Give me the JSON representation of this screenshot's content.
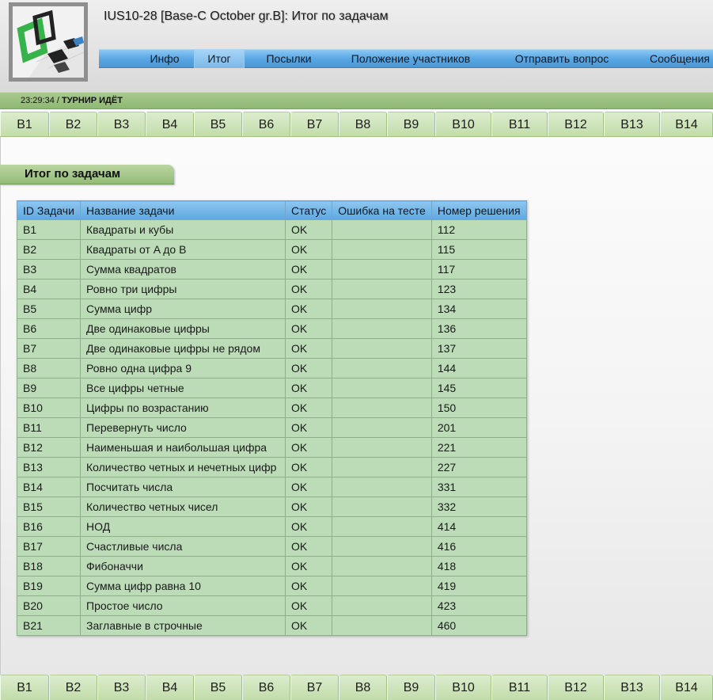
{
  "header": {
    "title": "IUS10-28 [Base-C October gr.B]: Итог по задачам"
  },
  "nav": {
    "items": [
      {
        "label": "Инфо",
        "active": false
      },
      {
        "label": "Итог",
        "active": true
      },
      {
        "label": "Посылки",
        "active": false
      },
      {
        "label": "Положение участников",
        "active": false
      },
      {
        "label": "Отправить вопрос",
        "active": false
      },
      {
        "label": "Сообщения",
        "active": false
      }
    ]
  },
  "status": {
    "time": "23:29:34",
    "separator": " / ",
    "state": "ТУРНИР ИДЁТ"
  },
  "problem_tabs": [
    "B1",
    "B2",
    "B3",
    "B4",
    "B5",
    "B6",
    "B7",
    "B8",
    "B9",
    "B10",
    "B11",
    "B12",
    "B13",
    "B14"
  ],
  "section": {
    "title": "Итог по задачам"
  },
  "table": {
    "headers": [
      "ID Задачи",
      "Название задачи",
      "Статус",
      "Ошибка на тесте",
      "Номер решения"
    ],
    "rows": [
      [
        "B1",
        "Квадраты и кубы",
        "OK",
        "",
        "112"
      ],
      [
        "B2",
        "Квадраты от A до B",
        "OK",
        "",
        "115"
      ],
      [
        "B3",
        "Сумма квадратов",
        "OK",
        "",
        "117"
      ],
      [
        "B4",
        "Ровно три цифры",
        "OK",
        "",
        "123"
      ],
      [
        "B5",
        "Сумма цифр",
        "OK",
        "",
        "134"
      ],
      [
        "B6",
        "Две одинаковые цифры",
        "OK",
        "",
        "136"
      ],
      [
        "B7",
        "Две одинаковые цифры не рядом",
        "OK",
        "",
        "137"
      ],
      [
        "B8",
        "Ровно одна цифра 9",
        "OK",
        "",
        "144"
      ],
      [
        "B9",
        "Все цифры четные",
        "OK",
        "",
        "145"
      ],
      [
        "B10",
        "Цифры по возрастанию",
        "OK",
        "",
        "150"
      ],
      [
        "B11",
        "Перевернуть число",
        "OK",
        "",
        "201"
      ],
      [
        "B12",
        "Наименьшая и наибольшая цифра",
        "OK",
        "",
        "221"
      ],
      [
        "B13",
        "Количество четных и нечетных цифр",
        "OK",
        "",
        "227"
      ],
      [
        "B14",
        "Посчитать числа",
        "OK",
        "",
        "331"
      ],
      [
        "B15",
        "Количество четных чисел",
        "OK",
        "",
        "332"
      ],
      [
        "B16",
        "НОД",
        "OK",
        "",
        "414"
      ],
      [
        "B17",
        "Счастливые числа",
        "OK",
        "",
        "416"
      ],
      [
        "B18",
        "Фибоначчи",
        "OK",
        "",
        "418"
      ],
      [
        "B19",
        "Сумма цифр равна 10",
        "OK",
        "",
        "419"
      ],
      [
        "B20",
        "Простое число",
        "OK",
        "",
        "423"
      ],
      [
        "B21",
        "Заглавные в строчные",
        "OK",
        "",
        "460"
      ]
    ]
  }
}
